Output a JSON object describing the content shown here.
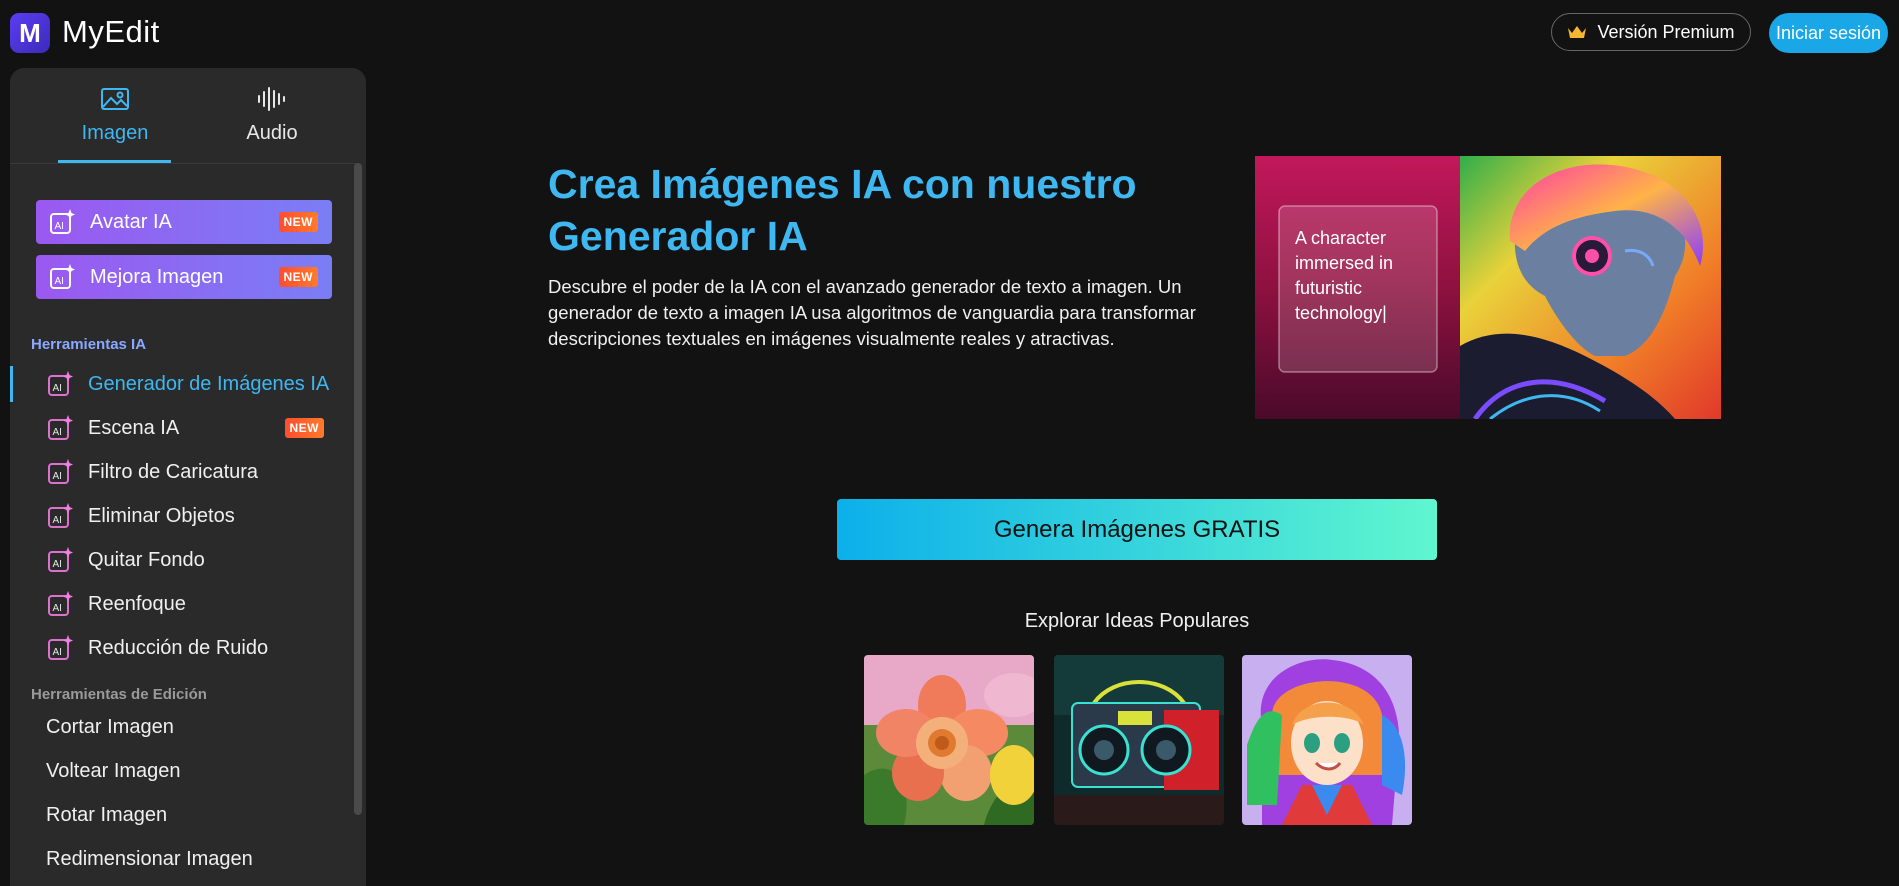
{
  "header": {
    "brand": "MyEdit",
    "logo_letter": "M",
    "premium_label": "Versión Premium",
    "login_label": "Iniciar sesión"
  },
  "sidebar": {
    "tabs": [
      {
        "label": "Imagen",
        "icon": "image-icon",
        "active": true
      },
      {
        "label": "Audio",
        "icon": "waveform-icon",
        "active": false
      }
    ],
    "promos": [
      {
        "label": "Avatar IA",
        "badge": "NEW"
      },
      {
        "label": "Mejora Imagen",
        "badge": "NEW"
      }
    ],
    "ai_section_label": "Herramientas IA",
    "ai_tools": [
      {
        "label": "Generador de Imágenes IA",
        "active": true
      },
      {
        "label": "Escena IA",
        "badge": "NEW"
      },
      {
        "label": "Filtro de Caricatura"
      },
      {
        "label": "Eliminar Objetos"
      },
      {
        "label": "Quitar Fondo"
      },
      {
        "label": "Reenfoque"
      },
      {
        "label": "Reducción de Ruido"
      }
    ],
    "edit_section_label": "Herramientas de Edición",
    "edit_tools": [
      {
        "label": "Cortar Imagen"
      },
      {
        "label": "Voltear Imagen"
      },
      {
        "label": "Rotar Imagen"
      },
      {
        "label": "Redimensionar Imagen"
      }
    ]
  },
  "main": {
    "title": "Crea Imágenes IA con nuestro Generador IA",
    "description": "Descubre el poder de la IA con el avanzado generador de texto a imagen. Un generador de texto a imagen IA usa algoritmos de vanguardia para transformar descripciones textuales en imágenes visualmente reales y atractivas.",
    "hero_prompt": "A character immersed in futuristic technology|",
    "cta_label": "Genera Imágenes GRATIS",
    "explore_title": "Explorar Ideas Populares",
    "thumbnails": [
      "flower-thumbnail",
      "boombox-thumbnail",
      "anime-girl-thumbnail"
    ]
  },
  "colors": {
    "accent": "#3fb7f0",
    "background": "#121212",
    "sidebar": "#2a2a2a",
    "section_ai": "#8aa8ff",
    "section_edit": "#9a9a9a"
  }
}
